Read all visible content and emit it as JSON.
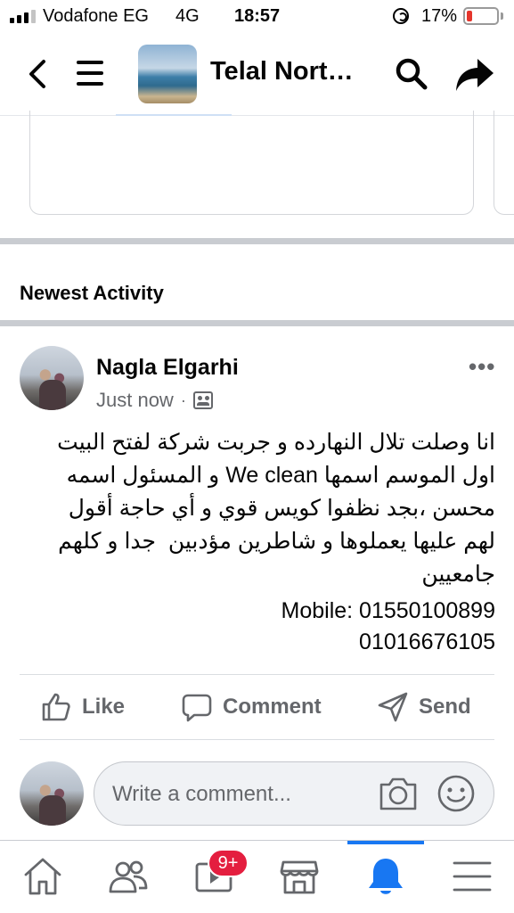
{
  "status_bar": {
    "carrier": "Vodafone EG",
    "network": "4G",
    "time": "18:57",
    "battery_percent": "17%",
    "battery_level": 0.17,
    "battery_color": "#e5352c"
  },
  "header": {
    "title": "Telal Nort…",
    "icons": [
      "back-chevron-icon",
      "menu-icon",
      "group-cover-image",
      "search-icon",
      "share-icon"
    ]
  },
  "section": {
    "title": "Newest Activity"
  },
  "post": {
    "author": "Nagla Elgarhi",
    "time": "Just now",
    "separator": "·",
    "more": "•••",
    "body": "انا وصلت تلال النهارده و جربت شركة لفتح البيت\nاول الموسم اسمها We clean و المسئول اسمه\nمحسن ،بجد نظفوا كويس قوي و أي حاجة أقول\nلهم عليها يعملوها و شاطرين مؤدبين  جدا و كلهم\nجامعيين",
    "contact": "Mobile: 01550100899\n01016676105",
    "actions": {
      "like": "Like",
      "comment": "Comment",
      "send": "Send"
    }
  },
  "comment_input": {
    "placeholder": "Write a comment..."
  },
  "tab_bar": {
    "tabs": [
      "home-icon",
      "friends-icon",
      "watch-icon",
      "marketplace-icon",
      "notifications-icon",
      "menu-icon"
    ],
    "active_tab": "notifications-icon",
    "watch_badge": "9+",
    "accent_color": "#1877f2",
    "badge_color": "#e41e3f"
  }
}
